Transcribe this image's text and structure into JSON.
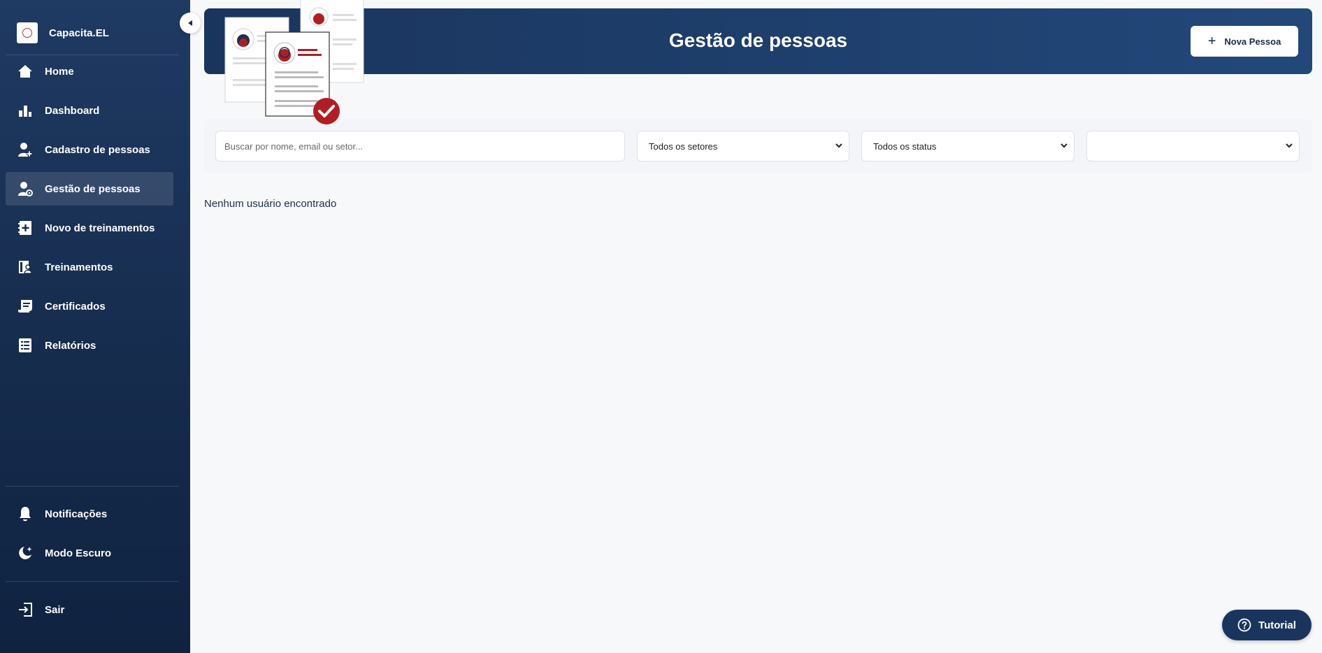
{
  "app": {
    "name": "Capacita.EL"
  },
  "sidebar": {
    "items": [
      {
        "label": "Home",
        "icon": "home-icon"
      },
      {
        "label": "Dashboard",
        "icon": "bar-chart-icon"
      },
      {
        "label": "Cadastro de pessoas",
        "icon": "user-plus-icon"
      },
      {
        "label": "Gestão de pessoas",
        "icon": "user-gear-icon",
        "active": true
      },
      {
        "label": "Novo de treinamentos",
        "icon": "notebook-plus-icon"
      },
      {
        "label": "Treinamentos",
        "icon": "book-user-icon"
      },
      {
        "label": "Certificados",
        "icon": "certificate-icon"
      },
      {
        "label": "Relatórios",
        "icon": "report-icon"
      }
    ],
    "bottom_items": [
      {
        "label": "Notificações",
        "icon": "bell-icon"
      },
      {
        "label": "Modo Escuro",
        "icon": "moon-icon"
      }
    ],
    "logout": {
      "label": "Sair",
      "icon": "logout-icon"
    }
  },
  "header": {
    "title": "Gestão de pessoas",
    "new_person_label": "Nova Pessoa"
  },
  "filters": {
    "search_placeholder": "Buscar por nome, email ou setor...",
    "sector_value": "Todos os setores",
    "status_value": "Todos os status",
    "extra_value": ""
  },
  "main": {
    "empty_message": "Nenhum usuário encontrado"
  },
  "tutorial": {
    "label": "Tutorial"
  },
  "colors": {
    "sidebar_bg": "#162c4d",
    "banner_bg": "#1a355d",
    "accent_red": "#b01e23",
    "page_bg": "#f7f8fa"
  }
}
